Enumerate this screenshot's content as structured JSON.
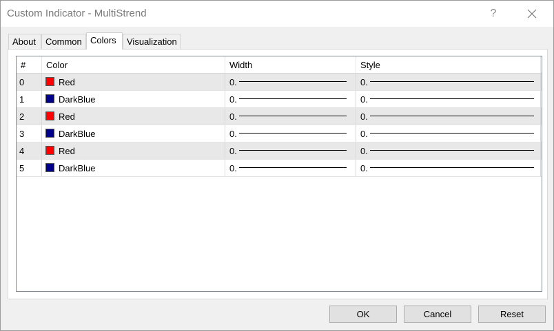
{
  "window": {
    "title": "Custom Indicator - MultiStrend",
    "help_label": "?"
  },
  "tabs": [
    {
      "label": "About",
      "active": false
    },
    {
      "label": "Common",
      "active": false
    },
    {
      "label": "Colors",
      "active": true
    },
    {
      "label": "Visualization",
      "active": false
    }
  ],
  "table": {
    "headers": [
      "#",
      "Color",
      "Width",
      "Style"
    ],
    "rows": [
      {
        "index": "0",
        "color_name": "Red",
        "color_hex": "#ff0000",
        "width": "0.",
        "style": "0."
      },
      {
        "index": "1",
        "color_name": "DarkBlue",
        "color_hex": "#00008b",
        "width": "0.",
        "style": "0."
      },
      {
        "index": "2",
        "color_name": "Red",
        "color_hex": "#ff0000",
        "width": "0.",
        "style": "0."
      },
      {
        "index": "3",
        "color_name": "DarkBlue",
        "color_hex": "#00008b",
        "width": "0.",
        "style": "0."
      },
      {
        "index": "4",
        "color_name": "Red",
        "color_hex": "#ff0000",
        "width": "0.",
        "style": "0."
      },
      {
        "index": "5",
        "color_name": "DarkBlue",
        "color_hex": "#00008b",
        "width": "0.",
        "style": "0."
      }
    ]
  },
  "buttons": {
    "ok": "OK",
    "cancel": "Cancel",
    "reset": "Reset"
  }
}
